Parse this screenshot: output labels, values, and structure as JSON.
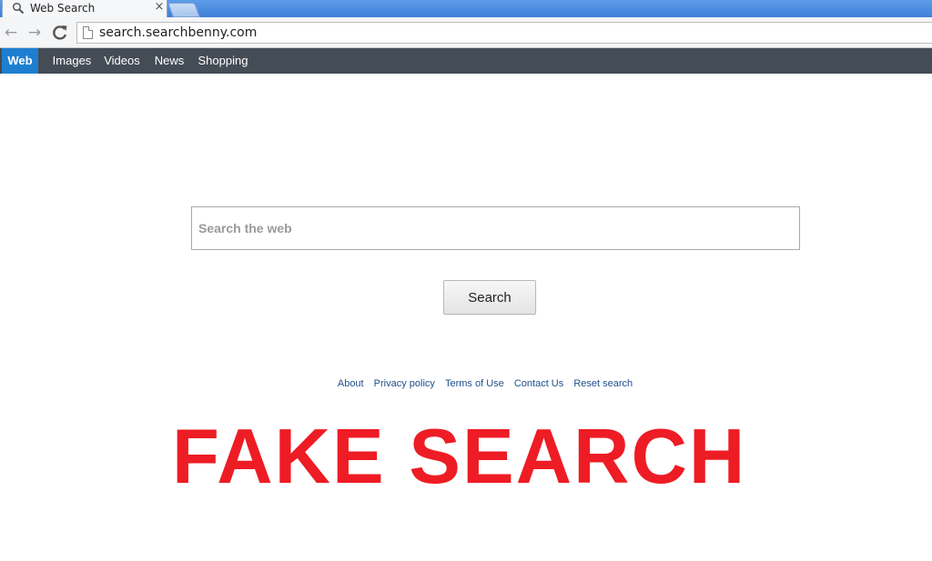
{
  "browser": {
    "tab": {
      "title": "Web Search",
      "close_glyph": "×"
    },
    "toolbar": {
      "back_glyph": "←",
      "forward_glyph": "→",
      "reload_glyph": "C",
      "url": "search.searchbenny.com"
    }
  },
  "sitenav": {
    "items": [
      {
        "label": "Web",
        "active": true
      },
      {
        "label": "Images",
        "active": false
      },
      {
        "label": "Videos",
        "active": false
      },
      {
        "label": "News",
        "active": false
      },
      {
        "label": "Shopping",
        "active": false
      }
    ],
    "active_color": "#1e7fd0",
    "bar_color": "#444c55"
  },
  "search": {
    "placeholder": "Search the web",
    "value": "",
    "button_label": "Search"
  },
  "footer": {
    "links": [
      "About",
      "Privacy policy",
      "Terms of Use",
      "Contact Us",
      "Reset search"
    ]
  },
  "overlay": {
    "text": "FAKE SEARCH",
    "color": "#ee1c24"
  }
}
